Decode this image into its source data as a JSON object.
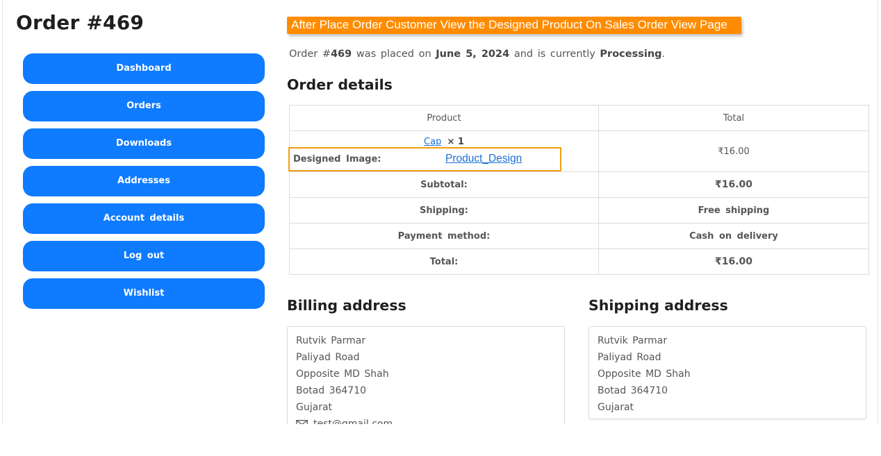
{
  "page": {
    "title": "Order #469"
  },
  "nav": {
    "items": [
      {
        "label": "Dashboard"
      },
      {
        "label": "Orders"
      },
      {
        "label": "Downloads"
      },
      {
        "label": "Addresses"
      },
      {
        "label": "Account details"
      },
      {
        "label": "Log out"
      },
      {
        "label": "Wishlist"
      }
    ]
  },
  "banner": {
    "text": "After Place Order Customer View the Designed Product On Sales Order View Page"
  },
  "status": {
    "prefix": "Order #",
    "order_number": "469",
    "middle": "was placed on",
    "date": "June 5, 2024",
    "middle2": "and is currently",
    "state": "Processing",
    "suffix": "."
  },
  "order_details": {
    "heading": "Order details",
    "columns": [
      "Product",
      "Total"
    ],
    "item": {
      "name": "Cap",
      "qty": "× 1",
      "total": "₹16.00",
      "designed_image_label": "Designed Image:",
      "designed_image_link": "Product_Design"
    },
    "rows": [
      {
        "label": "Subtotal:",
        "value": "₹16.00"
      },
      {
        "label": "Shipping:",
        "value": "Free shipping"
      },
      {
        "label": "Payment method:",
        "value": "Cash on delivery"
      },
      {
        "label": "Total:",
        "value": "₹16.00"
      }
    ]
  },
  "billing": {
    "heading": "Billing address",
    "lines": [
      "Rutvik Parmar",
      "Paliyad Road",
      "Opposite MD Shah",
      "Botad 364710",
      "Gujarat"
    ],
    "email": "test@gmail.com"
  },
  "shipping": {
    "heading": "Shipping address",
    "lines": [
      "Rutvik Parmar",
      "Paliyad Road",
      "Opposite MD Shah",
      "Botad 364710",
      "Gujarat"
    ]
  },
  "colors": {
    "accent": "#0f7bff",
    "banner": "#ff8c00",
    "highlight": "#f39c12"
  }
}
